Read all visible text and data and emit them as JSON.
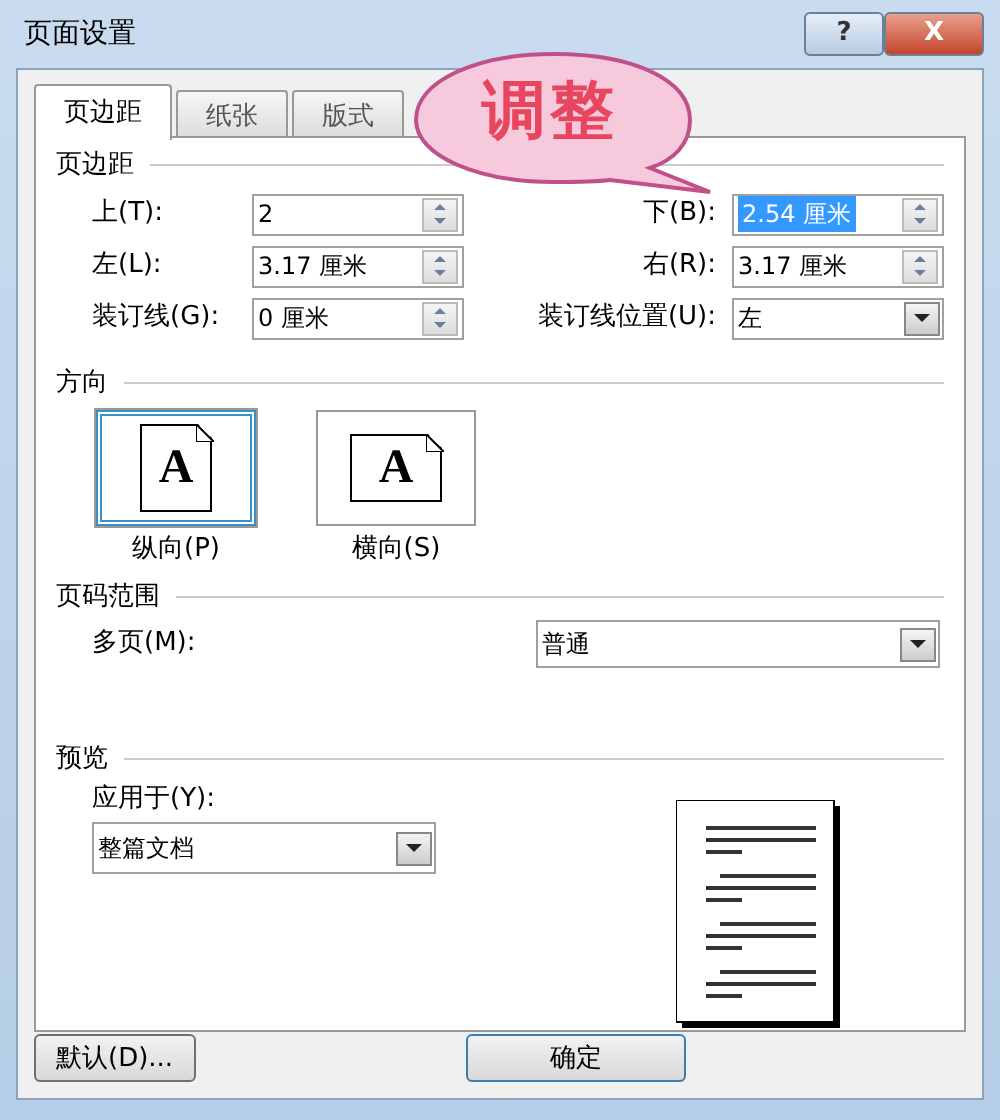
{
  "window": {
    "title": "页面设置",
    "buttons": [
      {
        "label": "?",
        "kind": "help"
      },
      {
        "label": "X",
        "kind": "close"
      }
    ]
  },
  "callout": {
    "text": "调整"
  },
  "tabs": [
    {
      "label": "页边距",
      "selected": true
    },
    {
      "label": "纸张",
      "selected": false
    },
    {
      "label": "版式",
      "selected": false
    }
  ],
  "margins": {
    "heading": "页边距",
    "fields": [
      {
        "label": "上(T):",
        "value": "2",
        "kind": "spin",
        "selected": false
      },
      {
        "label": "下(B):",
        "value": "2.54 厘米",
        "kind": "spin",
        "selected": true
      },
      {
        "label": "左(L):",
        "value": "3.17 厘米",
        "kind": "spin",
        "selected": false
      },
      {
        "label": "右(R):",
        "value": "3.17 厘米",
        "kind": "spin",
        "selected": false
      },
      {
        "label": "装订线(G):",
        "value": "0 厘米",
        "kind": "spin",
        "selected": false
      },
      {
        "label": "装订线位置(U):",
        "value": "左",
        "kind": "dropdown",
        "selected": false
      }
    ]
  },
  "orientation": {
    "heading": "方向",
    "options": [
      {
        "label": "纵向(P)",
        "glyph": "A",
        "kind": "portrait",
        "selected": true
      },
      {
        "label": "横向(S)",
        "glyph": "A",
        "kind": "landscape",
        "selected": false
      }
    ]
  },
  "pages": {
    "heading": "页码范围",
    "label": "多页(M):",
    "value": "普通"
  },
  "preview": {
    "heading": "预览",
    "label": "应用于(Y):",
    "value": "整篇文档"
  },
  "footer_buttons": [
    "默认(D)...",
    "确定"
  ]
}
